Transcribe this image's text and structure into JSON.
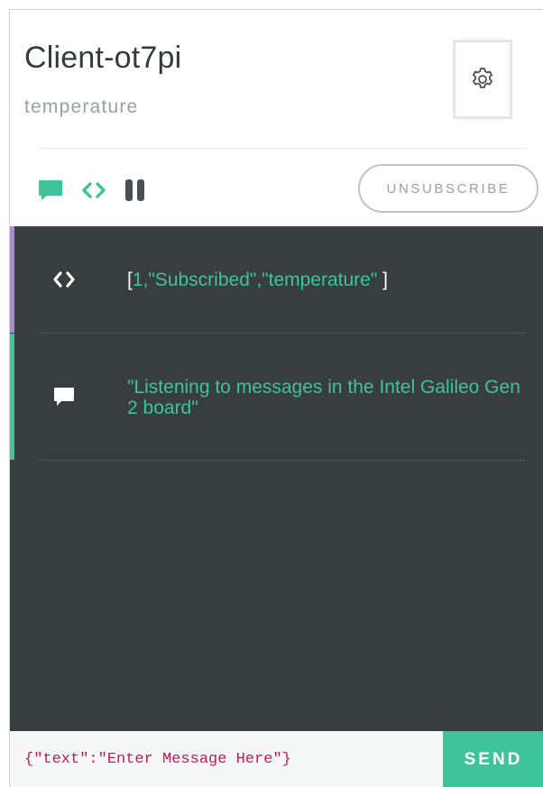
{
  "header": {
    "title": "Client-ot7pi",
    "subtitle": "temperature"
  },
  "toolbar": {
    "unsubscribe_label": "UNSUBSCRIBE",
    "icons": [
      "message-icon",
      "code-icon",
      "pause-icon"
    ]
  },
  "settings": {
    "icon": "gear-icon"
  },
  "log": {
    "entries": [
      {
        "kind": "code",
        "icon": "code-icon",
        "text": "[1,\"Subscribed\",\"temperature\"]",
        "bar_color": "#a98bd8"
      },
      {
        "kind": "message",
        "icon": "message-icon",
        "text": "\"Listening to messages in the Intel Galileo Gen 2 board\"",
        "bar_color": "#3fc39a"
      }
    ]
  },
  "composer": {
    "placeholder": "{\"text\":\"Enter Message Here\"}",
    "send_label": "SEND"
  },
  "colors": {
    "accent": "#3fc39a",
    "log_background": "#383d40",
    "code_bar": "#a98bd8",
    "message_bar": "#3fc39a",
    "input_text": "#c2185b"
  }
}
